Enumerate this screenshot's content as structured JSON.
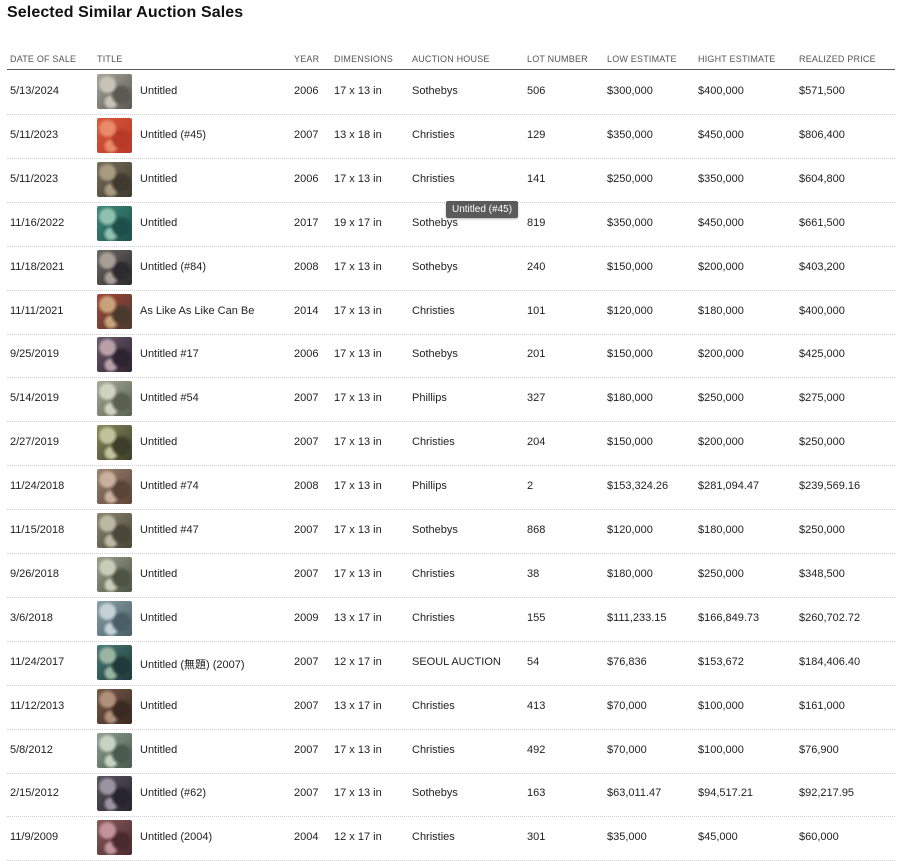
{
  "page": {
    "title": "Selected Similar Auction Sales"
  },
  "table": {
    "headers": {
      "date": "DATE OF SALE",
      "title": "TITLE",
      "year": "YEAR",
      "dimensions": "DIMENSIONS",
      "house": "AUCTION HOUSE",
      "lot": "LOT NUMBER",
      "low": "LOW ESTIMATE",
      "high": "HIGHT ESTIMATE",
      "realized": "REALIZED PRICE"
    },
    "rows": [
      {
        "date": "5/13/2024",
        "title": "Untitled",
        "year": "2006",
        "dimensions": "17 x 13 in",
        "house": "Sothebys",
        "lot": "506",
        "low": "$300,000",
        "high": "$400,000",
        "realized": "$571,500",
        "thumb_colors": [
          "#a9a59a",
          "#5b5a52",
          "#c7c3b8"
        ]
      },
      {
        "date": "5/11/2023",
        "title": "Untitled (#45)",
        "year": "2007",
        "dimensions": "13 x 18 in",
        "house": "Christies",
        "lot": "129",
        "low": "$350,000",
        "high": "$450,000",
        "realized": "$806,400",
        "thumb_colors": [
          "#d9583a",
          "#b63a27",
          "#e98a6a"
        ]
      },
      {
        "date": "5/11/2023",
        "title": "Untitled",
        "year": "2006",
        "dimensions": "17 x 13 in",
        "house": "Christies",
        "lot": "141",
        "low": "$250,000",
        "high": "$350,000",
        "realized": "$604,800",
        "thumb_colors": [
          "#7b6f5a",
          "#3f3a30",
          "#a89a80"
        ]
      },
      {
        "date": "11/16/2022",
        "title": "Untitled",
        "year": "2017",
        "dimensions": "19 x 17 in",
        "house": "Sothebys",
        "lot": "819",
        "low": "$350,000",
        "high": "$450,000",
        "realized": "$661,500",
        "thumb_colors": [
          "#3f8a7c",
          "#1e4f4a",
          "#8fc0b0"
        ]
      },
      {
        "date": "11/18/2021",
        "title": "Untitled (#84)",
        "year": "2008",
        "dimensions": "17 x 13 in",
        "house": "Sothebys",
        "lot": "240",
        "low": "$150,000",
        "high": "$200,000",
        "realized": "$403,200",
        "thumb_colors": [
          "#6e6a66",
          "#2c2b2d",
          "#a89e96"
        ]
      },
      {
        "date": "11/11/2021",
        "title": "As Like As Like Can Be",
        "year": "2014",
        "dimensions": "17 x 13 in",
        "house": "Christies",
        "lot": "101",
        "low": "$120,000",
        "high": "$180,000",
        "realized": "$400,000",
        "thumb_colors": [
          "#a6463a",
          "#4a3a2e",
          "#c9a27a"
        ]
      },
      {
        "date": "9/25/2019",
        "title": "Untitled #17",
        "year": "2006",
        "dimensions": "17 x 13 in",
        "house": "Sothebys",
        "lot": "201",
        "low": "$150,000",
        "high": "$200,000",
        "realized": "$425,000",
        "thumb_colors": [
          "#6a5a6e",
          "#2e2430",
          "#b9a0a8"
        ]
      },
      {
        "date": "5/14/2019",
        "title": "Untitled #54",
        "year": "2007",
        "dimensions": "17 x 13 in",
        "house": "Phillips",
        "lot": "327",
        "low": "$180,000",
        "high": "$250,000",
        "realized": "$275,000",
        "thumb_colors": [
          "#a7ad9a",
          "#5a6050",
          "#d0d2c2"
        ]
      },
      {
        "date": "2/27/2019",
        "title": "Untitled",
        "year": "2007",
        "dimensions": "17 x 13 in",
        "house": "Christies",
        "lot": "204",
        "low": "$150,000",
        "high": "$200,000",
        "realized": "$250,000",
        "thumb_colors": [
          "#8a8a60",
          "#3c3e2a",
          "#c2c29a"
        ]
      },
      {
        "date": "11/24/2018",
        "title": "Untitled #74",
        "year": "2008",
        "dimensions": "17 x 13 in",
        "house": "Phillips",
        "lot": "2",
        "low": "$153,324.26",
        "high": "$281,094.47",
        "realized": "$239,569.16",
        "thumb_colors": [
          "#9a8272",
          "#5a4438",
          "#c8b09c"
        ]
      },
      {
        "date": "11/15/2018",
        "title": "Untitled #47",
        "year": "2007",
        "dimensions": "17 x 13 in",
        "house": "Sothebys",
        "lot": "868",
        "low": "$120,000",
        "high": "$180,000",
        "realized": "$250,000",
        "thumb_colors": [
          "#8b8672",
          "#4a4638",
          "#bdb8a2"
        ]
      },
      {
        "date": "9/26/2018",
        "title": "Untitled",
        "year": "2007",
        "dimensions": "17 x 13 in",
        "house": "Christies",
        "lot": "38",
        "low": "$180,000",
        "high": "$250,000",
        "realized": "$348,500",
        "thumb_colors": [
          "#9aa08a",
          "#4e5444",
          "#c8ccb8"
        ]
      },
      {
        "date": "3/6/2018",
        "title": "Untitled",
        "year": "2009",
        "dimensions": "13 x 17 in",
        "house": "Christies",
        "lot": "155",
        "low": "$111,233.15",
        "high": "$166,849.73",
        "realized": "$260,702.72",
        "thumb_colors": [
          "#8aa0a8",
          "#4a5e66",
          "#c4d2d6"
        ]
      },
      {
        "date": "11/24/2017",
        "title": "Untitled (無題) (2007)",
        "year": "2007",
        "dimensions": "12 x 17 in",
        "house": "SEOUL AUCTION",
        "lot": "54",
        "low": "$76,836",
        "high": "$153,672",
        "realized": "$184,406.40",
        "thumb_colors": [
          "#4a7a76",
          "#1f3a3a",
          "#9ab4a2"
        ]
      },
      {
        "date": "11/12/2013",
        "title": "Untitled",
        "year": "2007",
        "dimensions": "13 x 17 in",
        "house": "Christies",
        "lot": "413",
        "low": "$70,000",
        "high": "$100,000",
        "realized": "$161,000",
        "thumb_colors": [
          "#7a5a4a",
          "#3a2a22",
          "#b0907a"
        ]
      },
      {
        "date": "5/8/2012",
        "title": "Untitled",
        "year": "2007",
        "dimensions": "17 x 13 in",
        "house": "Christies",
        "lot": "492",
        "low": "$70,000",
        "high": "$100,000",
        "realized": "$76,900",
        "thumb_colors": [
          "#8fa08e",
          "#4a5a4e",
          "#c6d2c2"
        ]
      },
      {
        "date": "2/15/2012",
        "title": "Untitled (#62)",
        "year": "2007",
        "dimensions": "17 x 13 in",
        "house": "Sothebys",
        "lot": "163",
        "low": "$63,011.47",
        "high": "$94,517.21",
        "realized": "$92,217.95",
        "thumb_colors": [
          "#5a5660",
          "#26242c",
          "#9a94a0"
        ]
      },
      {
        "date": "11/9/2009",
        "title": "Untitled (2004)",
        "year": "2004",
        "dimensions": "12 x 17 in",
        "house": "Christies",
        "lot": "301",
        "low": "$35,000",
        "high": "$45,000",
        "realized": "$60,000",
        "thumb_colors": [
          "#8a5a5a",
          "#4a2a2e",
          "#c2949a"
        ]
      }
    ]
  },
  "tooltip": {
    "text": "Untitled (#45)"
  }
}
